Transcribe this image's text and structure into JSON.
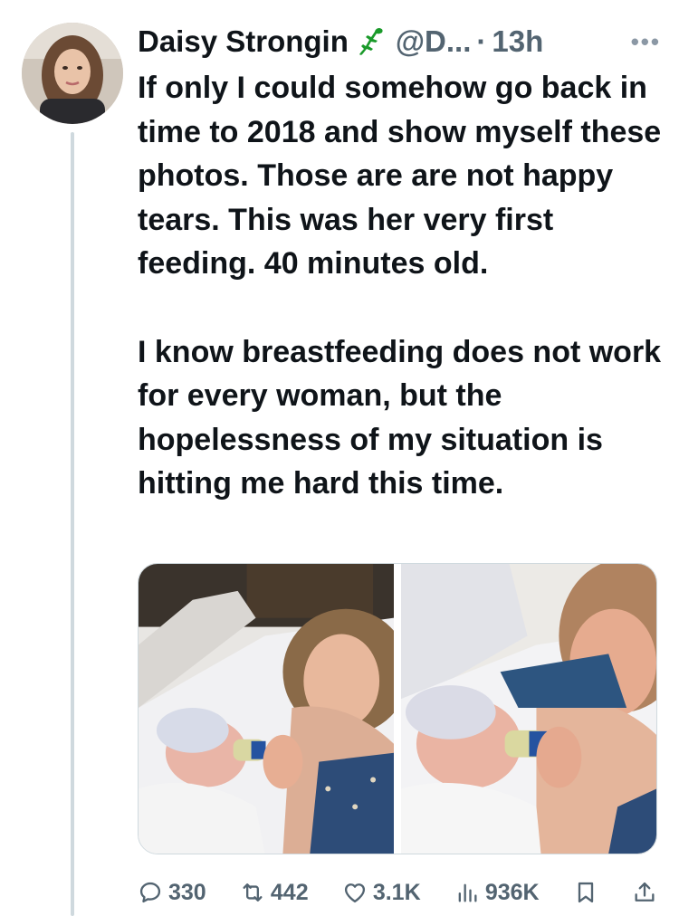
{
  "author": {
    "name": "Daisy Strongin",
    "handle": "@D...",
    "separator": "·",
    "time": "13h",
    "badge_icon": "lizard-icon",
    "more_icon": "more-icon"
  },
  "tweet": {
    "text": "If only I could somehow go back in time to 2018 and show myself these photos. Those are are not happy tears. This was her very first feeding. 40 minutes old.\n\nI know breastfeeding does not work for every woman, but the hopelessness of my situation is hitting me hard this time."
  },
  "media": {
    "photos": [
      {
        "description_icon": "photo-icon"
      },
      {
        "description_icon": "photo-icon"
      }
    ]
  },
  "actions": {
    "replies": "330",
    "reposts": "442",
    "likes": "3.1K",
    "views": "936K"
  },
  "colors": {
    "text": "#0f1419",
    "muted": "#536471",
    "thread_line": "#cfd9de",
    "lizard": "#1a9a2a"
  }
}
